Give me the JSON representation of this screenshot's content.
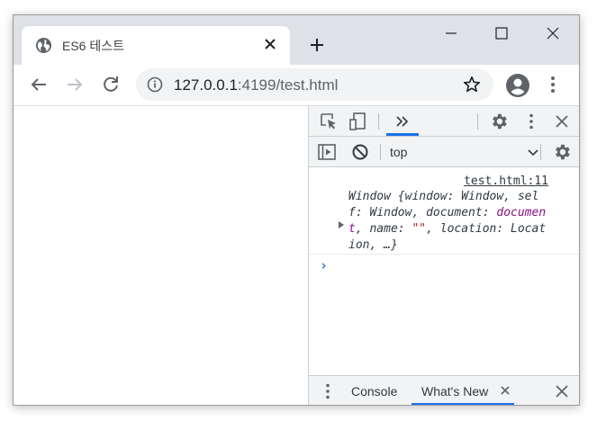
{
  "tab": {
    "title": "ES6 테스트"
  },
  "address": {
    "host": "127.0.0.1",
    "port": ":4199",
    "path": "/test.html"
  },
  "devtools": {
    "context": "top",
    "console": {
      "source": "test.html:11",
      "log_parts": [
        "Window {window: Window, self: Window, document: ",
        "document",
        ", name: ",
        "\"\"",
        ", location: Location, …}"
      ]
    },
    "drawer": {
      "tabs": [
        "Console",
        "What's New"
      ]
    }
  },
  "colors": {
    "accent": "#1a73e8",
    "titlebar": "#dee1e6",
    "devtools_bar": "#f1f3f4"
  }
}
